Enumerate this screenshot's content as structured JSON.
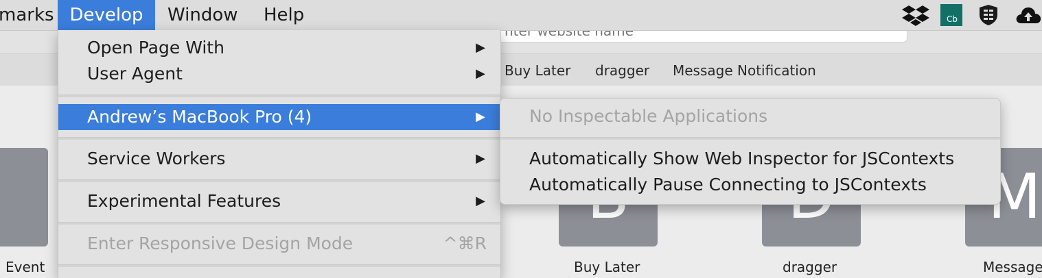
{
  "menubar": {
    "items": [
      {
        "label": "marks"
      },
      {
        "label": "Develop"
      },
      {
        "label": "Window"
      },
      {
        "label": "Help"
      }
    ],
    "status_icons": [
      "dropbox-icon",
      "cb-app-icon",
      "shield-app-icon",
      "cloud-upload-icon"
    ],
    "cb_text": "Cb"
  },
  "urlbar": {
    "placeholder": "nter website name"
  },
  "favorites_bar": {
    "items": [
      {
        "label": "Buy Later"
      },
      {
        "label": "dragger"
      },
      {
        "label": "Message Notification"
      }
    ]
  },
  "tiles": [
    {
      "letter": "",
      "label": "Event"
    },
    {
      "letter": "B",
      "label": "Buy Later"
    },
    {
      "letter": "D",
      "label": "dragger"
    },
    {
      "letter": "M",
      "label": "Message"
    }
  ],
  "develop_menu": {
    "items": [
      {
        "label": "Open Page With",
        "arrow": "▶"
      },
      {
        "label": "User Agent",
        "arrow": "▶"
      },
      {
        "label": "Andrew’s MacBook Pro (4)",
        "arrow": "▶"
      },
      {
        "label": "Service Workers",
        "arrow": "▶"
      },
      {
        "label": "Experimental Features",
        "arrow": "▶"
      },
      {
        "label": "Enter Responsive Design Mode",
        "shortcut": "^⌘R"
      }
    ]
  },
  "submenu": {
    "items": [
      {
        "label": "No Inspectable Applications"
      },
      {
        "label": "Automatically Show Web Inspector for JSContexts"
      },
      {
        "label": "Automatically Pause Connecting to JSContexts"
      }
    ]
  },
  "colors": {
    "accent": "#3b7ddb",
    "tile": "#8d8f97",
    "menu_bg": "#e2e2e2"
  }
}
